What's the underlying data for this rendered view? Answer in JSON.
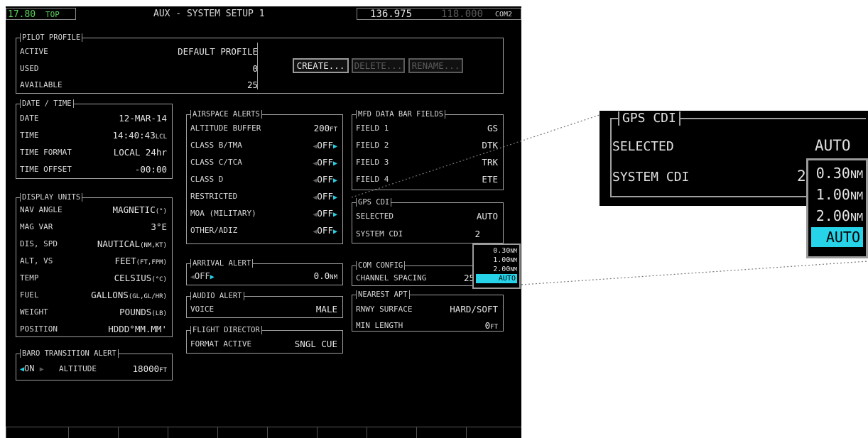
{
  "header": {
    "left_freq": "17.80",
    "left_tag": "TOP",
    "title": "AUX - SYSTEM SETUP 1",
    "com_active": "136.975",
    "com_standby": "118.000",
    "com_label": "COM2"
  },
  "pilot_profile": {
    "title": "PILOT PROFILE",
    "active_label": "ACTIVE",
    "active_value": "DEFAULT PROFILE",
    "used_label": "USED",
    "used_value": "0",
    "available_label": "AVAILABLE",
    "available_value": "25",
    "create_label": "CREATE...",
    "delete_label": "DELETE...",
    "rename_label": "RENAME..."
  },
  "date_time": {
    "title": "DATE / TIME",
    "date_label": "DATE",
    "date_value": "12-MAR-14",
    "time_label": "TIME",
    "time_value": "14:40:43",
    "time_unit": "LCL",
    "format_label": "TIME FORMAT",
    "format_value": "LOCAL 24hr",
    "offset_label": "TIME OFFSET",
    "offset_value": "-00:00"
  },
  "display_units": {
    "title": "DISPLAY UNITS",
    "rows": [
      {
        "label": "NAV ANGLE",
        "value": "MAGNETIC",
        "unit": "(°)"
      },
      {
        "label": "MAG VAR",
        "value": "3°E",
        "unit": ""
      },
      {
        "label": "DIS, SPD",
        "value": "NAUTICAL",
        "unit": "(NM,KT)"
      },
      {
        "label": "ALT, VS",
        "value": "FEET",
        "unit": "(FT,FPM)"
      },
      {
        "label": "TEMP",
        "value": "CELSIUS",
        "unit": "(°C)"
      },
      {
        "label": "FUEL",
        "value": "GALLONS",
        "unit": "(GL,GL/HR)"
      },
      {
        "label": "WEIGHT",
        "value": "POUNDS",
        "unit": "(LB)"
      },
      {
        "label": "POSITION",
        "value": "HDDD°MM.MM'",
        "unit": ""
      }
    ]
  },
  "baro": {
    "title": "BARO TRANSITION ALERT",
    "state": "ON",
    "altitude_label": "ALTITUDE",
    "altitude_value": "18000",
    "altitude_unit": "FT"
  },
  "airspace_alerts": {
    "title": "AIRSPACE ALERTS",
    "buffer_label": "ALTITUDE BUFFER",
    "buffer_value": "200",
    "buffer_unit": "FT",
    "rows": [
      {
        "label": "CLASS B/TMA",
        "value": "OFF"
      },
      {
        "label": "CLASS C/TCA",
        "value": "OFF"
      },
      {
        "label": "CLASS D",
        "value": "OFF"
      },
      {
        "label": "RESTRICTED",
        "value": "OFF"
      },
      {
        "label": "MOA (MILITARY)",
        "value": "OFF"
      },
      {
        "label": "OTHER/ADIZ",
        "value": "OFF"
      }
    ]
  },
  "arrival_alert": {
    "title": "ARRIVAL ALERT",
    "state": "OFF",
    "distance": "0.0",
    "unit": "NM"
  },
  "audio_alert": {
    "title": "AUDIO ALERT",
    "voice_label": "VOICE",
    "voice_value": "MALE"
  },
  "flight_director": {
    "title": "FLIGHT DIRECTOR",
    "format_label": "FORMAT ACTIVE",
    "format_value": "SNGL CUE"
  },
  "mfd_data_bar": {
    "title": "MFD DATA BAR FIELDS",
    "rows": [
      {
        "label": "FIELD 1",
        "value": "GS"
      },
      {
        "label": "FIELD 2",
        "value": "DTK"
      },
      {
        "label": "FIELD 3",
        "value": "TRK"
      },
      {
        "label": "FIELD 4",
        "value": "ETE"
      }
    ]
  },
  "gps_cdi": {
    "title": "GPS CDI",
    "selected_label": "SELECTED",
    "selected_value": "AUTO",
    "system_label": "SYSTEM CDI",
    "system_value": "2",
    "options": [
      "0.30",
      "1.00",
      "2.00",
      "AUTO"
    ],
    "option_unit": "NM"
  },
  "com_config": {
    "title": "COM CONFIG",
    "spacing_label": "CHANNEL SPACING",
    "spacing_value": "25"
  },
  "nearest_apt": {
    "title": "NEAREST APT",
    "surface_label": "RNWY SURFACE",
    "surface_value": "HARD/SOFT",
    "min_label": "MIN LENGTH",
    "min_value": "0",
    "min_unit": "FT"
  },
  "softkey_count": 12,
  "colors": {
    "accent": "#26d3e9",
    "active_green": "#5cd65c",
    "frame": "#a0a0a0"
  }
}
